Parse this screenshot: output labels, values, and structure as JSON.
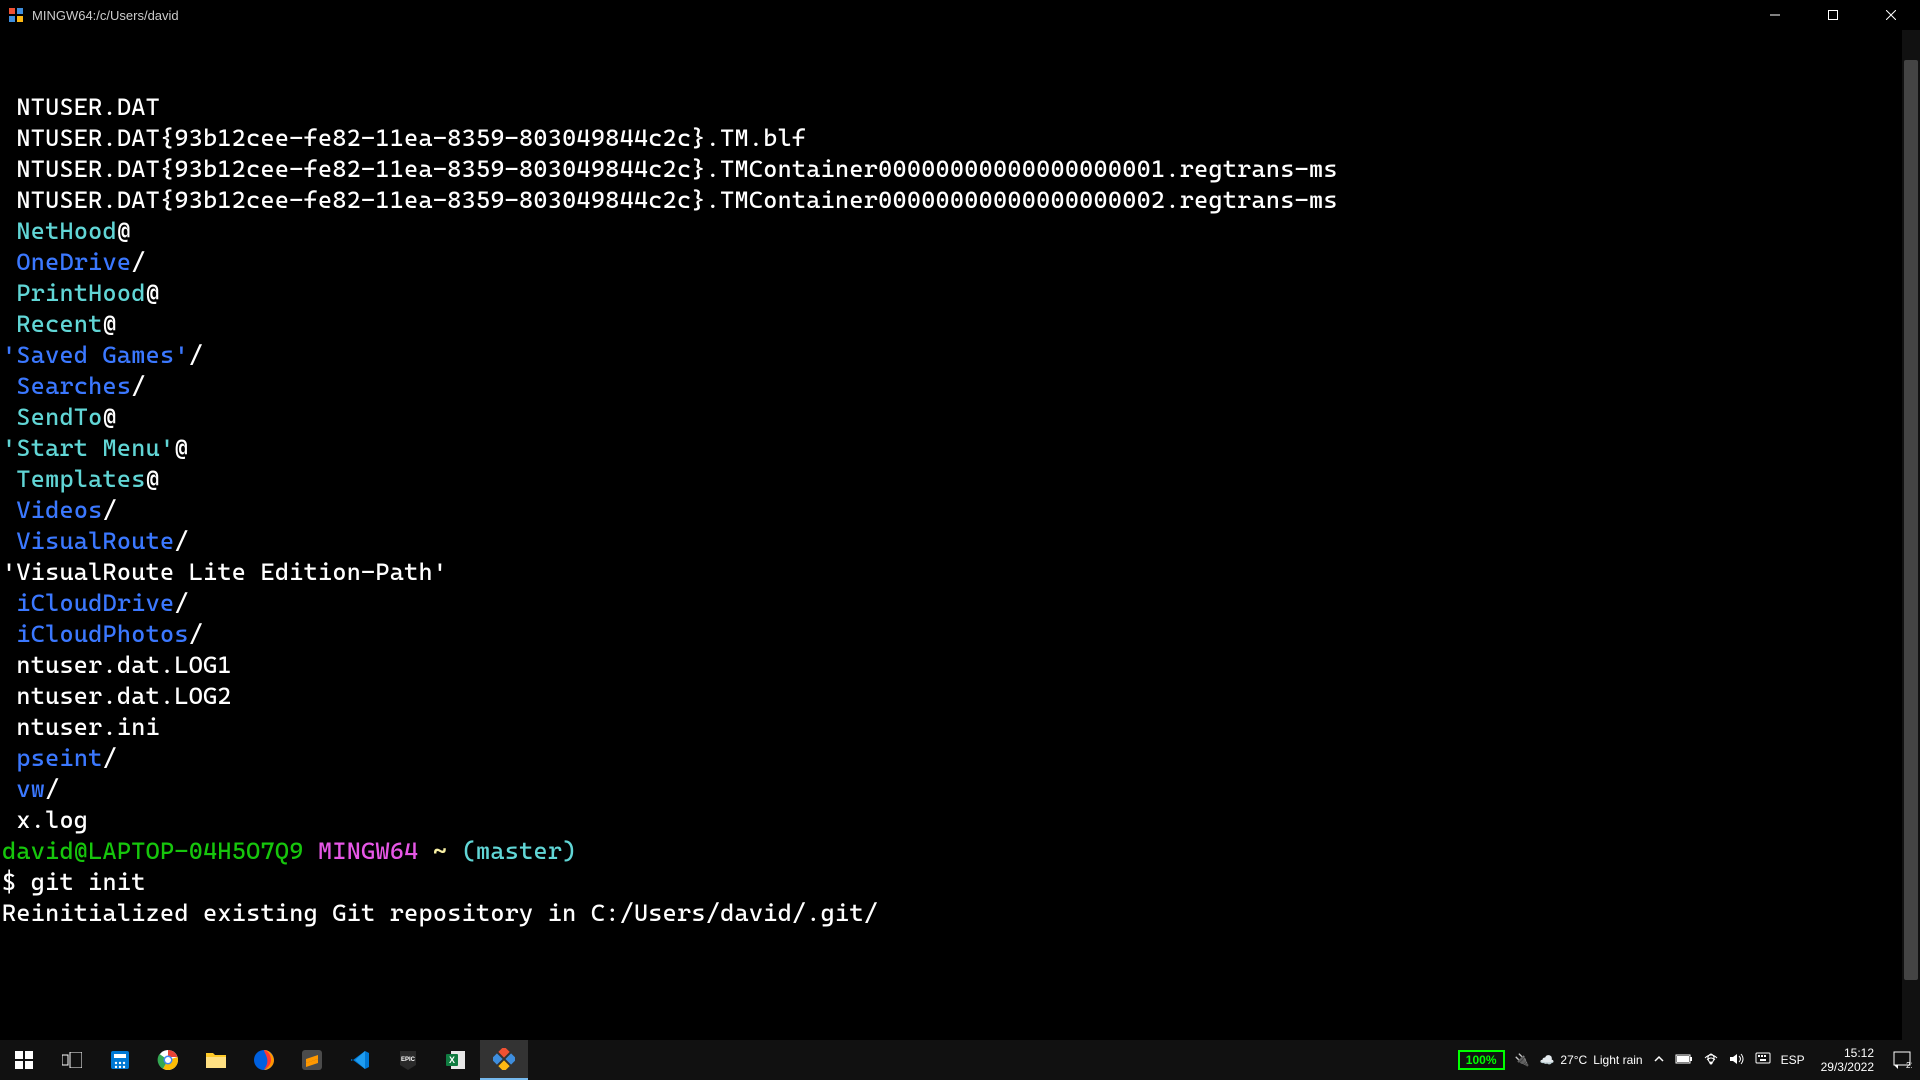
{
  "titlebar": {
    "title": "MINGW64:/c/Users/david"
  },
  "terminal": {
    "lines": [
      {
        "segments": [
          {
            "cls": "c-white",
            "text": " NTUSER.DAT"
          }
        ]
      },
      {
        "segments": [
          {
            "cls": "c-white",
            "text": " NTUSER.DAT{93b12cee-fe82-11ea-8359-803049844c2c}.TM.blf"
          }
        ]
      },
      {
        "segments": [
          {
            "cls": "c-white",
            "text": " NTUSER.DAT{93b12cee-fe82-11ea-8359-803049844c2c}.TMContainer00000000000000000001.regtrans-ms"
          }
        ]
      },
      {
        "segments": [
          {
            "cls": "c-white",
            "text": " NTUSER.DAT{93b12cee-fe82-11ea-8359-803049844c2c}.TMContainer00000000000000000002.regtrans-ms"
          }
        ]
      },
      {
        "segments": [
          {
            "cls": "c-white",
            "text": " "
          },
          {
            "cls": "c-cyan",
            "text": "NetHood"
          },
          {
            "cls": "c-white",
            "text": "@"
          }
        ]
      },
      {
        "segments": [
          {
            "cls": "c-white",
            "text": " "
          },
          {
            "cls": "c-blue",
            "text": "OneDrive"
          },
          {
            "cls": "c-white",
            "text": "/"
          }
        ]
      },
      {
        "segments": [
          {
            "cls": "c-white",
            "text": " "
          },
          {
            "cls": "c-cyan",
            "text": "PrintHood"
          },
          {
            "cls": "c-white",
            "text": "@"
          }
        ]
      },
      {
        "segments": [
          {
            "cls": "c-white",
            "text": " "
          },
          {
            "cls": "c-cyan",
            "text": "Recent"
          },
          {
            "cls": "c-white",
            "text": "@"
          }
        ]
      },
      {
        "segments": [
          {
            "cls": "c-blue",
            "text": "'Saved Games'"
          },
          {
            "cls": "c-white",
            "text": "/"
          }
        ]
      },
      {
        "segments": [
          {
            "cls": "c-white",
            "text": " "
          },
          {
            "cls": "c-blue",
            "text": "Searches"
          },
          {
            "cls": "c-white",
            "text": "/"
          }
        ]
      },
      {
        "segments": [
          {
            "cls": "c-white",
            "text": " "
          },
          {
            "cls": "c-cyan",
            "text": "SendTo"
          },
          {
            "cls": "c-white",
            "text": "@"
          }
        ]
      },
      {
        "segments": [
          {
            "cls": "c-cyan",
            "text": "'Start Menu'"
          },
          {
            "cls": "c-white",
            "text": "@"
          }
        ]
      },
      {
        "segments": [
          {
            "cls": "c-white",
            "text": " "
          },
          {
            "cls": "c-cyan",
            "text": "Templates"
          },
          {
            "cls": "c-white",
            "text": "@"
          }
        ]
      },
      {
        "segments": [
          {
            "cls": "c-white",
            "text": " "
          },
          {
            "cls": "c-blue",
            "text": "Videos"
          },
          {
            "cls": "c-white",
            "text": "/"
          }
        ]
      },
      {
        "segments": [
          {
            "cls": "c-white",
            "text": " "
          },
          {
            "cls": "c-blue",
            "text": "VisualRoute"
          },
          {
            "cls": "c-white",
            "text": "/"
          }
        ]
      },
      {
        "segments": [
          {
            "cls": "c-white",
            "text": "'VisualRoute Lite Edition-Path'"
          }
        ]
      },
      {
        "segments": [
          {
            "cls": "c-white",
            "text": " "
          },
          {
            "cls": "c-blue",
            "text": "iCloudDrive"
          },
          {
            "cls": "c-white",
            "text": "/"
          }
        ]
      },
      {
        "segments": [
          {
            "cls": "c-white",
            "text": " "
          },
          {
            "cls": "c-blue",
            "text": "iCloudPhotos"
          },
          {
            "cls": "c-white",
            "text": "/"
          }
        ]
      },
      {
        "segments": [
          {
            "cls": "c-white",
            "text": " ntuser.dat.LOG1"
          }
        ]
      },
      {
        "segments": [
          {
            "cls": "c-white",
            "text": " ntuser.dat.LOG2"
          }
        ]
      },
      {
        "segments": [
          {
            "cls": "c-white",
            "text": " ntuser.ini"
          }
        ]
      },
      {
        "segments": [
          {
            "cls": "c-white",
            "text": " "
          },
          {
            "cls": "c-blue",
            "text": "pseint"
          },
          {
            "cls": "c-white",
            "text": "/"
          }
        ]
      },
      {
        "segments": [
          {
            "cls": "c-white",
            "text": " "
          },
          {
            "cls": "c-blue",
            "text": "vw"
          },
          {
            "cls": "c-white",
            "text": "/"
          }
        ]
      },
      {
        "segments": [
          {
            "cls": "c-white",
            "text": " x.log"
          }
        ]
      },
      {
        "segments": [
          {
            "cls": "c-white",
            "text": ""
          }
        ]
      },
      {
        "segments": [
          {
            "cls": "c-green",
            "text": "david@LAPTOP-04H5O7Q9"
          },
          {
            "cls": "c-white",
            "text": " "
          },
          {
            "cls": "c-magenta",
            "text": "MINGW64"
          },
          {
            "cls": "c-white",
            "text": " "
          },
          {
            "cls": "c-yellow",
            "text": "~"
          },
          {
            "cls": "c-white",
            "text": " "
          },
          {
            "cls": "c-cyan",
            "text": "(master)"
          }
        ]
      },
      {
        "segments": [
          {
            "cls": "c-white",
            "text": "$ git init"
          }
        ]
      },
      {
        "segments": [
          {
            "cls": "c-white",
            "text": "Reinitialized existing Git repository in C:/Users/david/.git/"
          }
        ]
      }
    ]
  },
  "taskbar": {
    "battery": "100%",
    "weather_temp": "27°C",
    "weather_desc": "Light rain",
    "lang": "ESP",
    "time": "15:12",
    "date": "29/3/2022",
    "notif_count": "21"
  }
}
